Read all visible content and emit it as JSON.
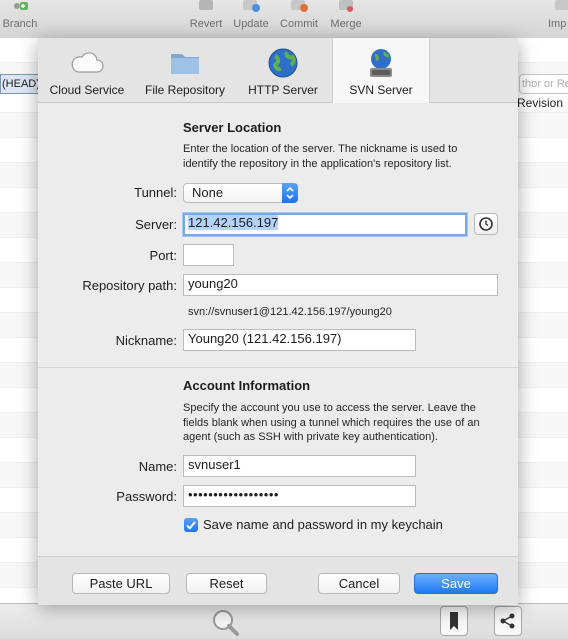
{
  "toolbar": {
    "branch": "Branch",
    "revert": "Revert",
    "update": "Update",
    "commit": "Commit",
    "merge": "Merge",
    "import": "Imp"
  },
  "background": {
    "head_label": "(HEAD)",
    "search_placeholder": "thor or Re",
    "revision_col": "Revision"
  },
  "tabs": [
    {
      "label": "Cloud Service",
      "icon": "cloud-icon"
    },
    {
      "label": "File Repository",
      "icon": "folder-icon"
    },
    {
      "label": "HTTP Server",
      "icon": "globe-icon"
    },
    {
      "label": "SVN Server",
      "icon": "svn-server-icon"
    }
  ],
  "server_location": {
    "title": "Server Location",
    "description": "Enter the location of the server. The nickname is used to identify the repository in the application's repository list.",
    "tunnel_label": "Tunnel:",
    "tunnel_value": "None",
    "server_label": "Server:",
    "server_value": "121.42.156.197",
    "port_label": "Port:",
    "port_value": "",
    "repo_path_label": "Repository path:",
    "repo_path_value": "young20",
    "url_preview": "svn://svnuser1@121.42.156.197/young20",
    "nickname_label": "Nickname:",
    "nickname_value": "Young20 (121.42.156.197)"
  },
  "account": {
    "title": "Account Information",
    "description": "Specify the account you use to access the server. Leave the fields blank when using a tunnel which requires the use of an agent (such as SSH with private key authentication).",
    "name_label": "Name:",
    "name_value": "svnuser1",
    "password_label": "Password:",
    "password_value": "••••••••••••••••••",
    "keychain_label": "Save name and password in my keychain",
    "keychain_checked": true
  },
  "buttons": {
    "paste_url": "Paste URL",
    "reset": "Reset",
    "cancel": "Cancel",
    "save": "Save"
  },
  "colors": {
    "accent": "#1f7af5",
    "selection": "#b4d3fb"
  }
}
